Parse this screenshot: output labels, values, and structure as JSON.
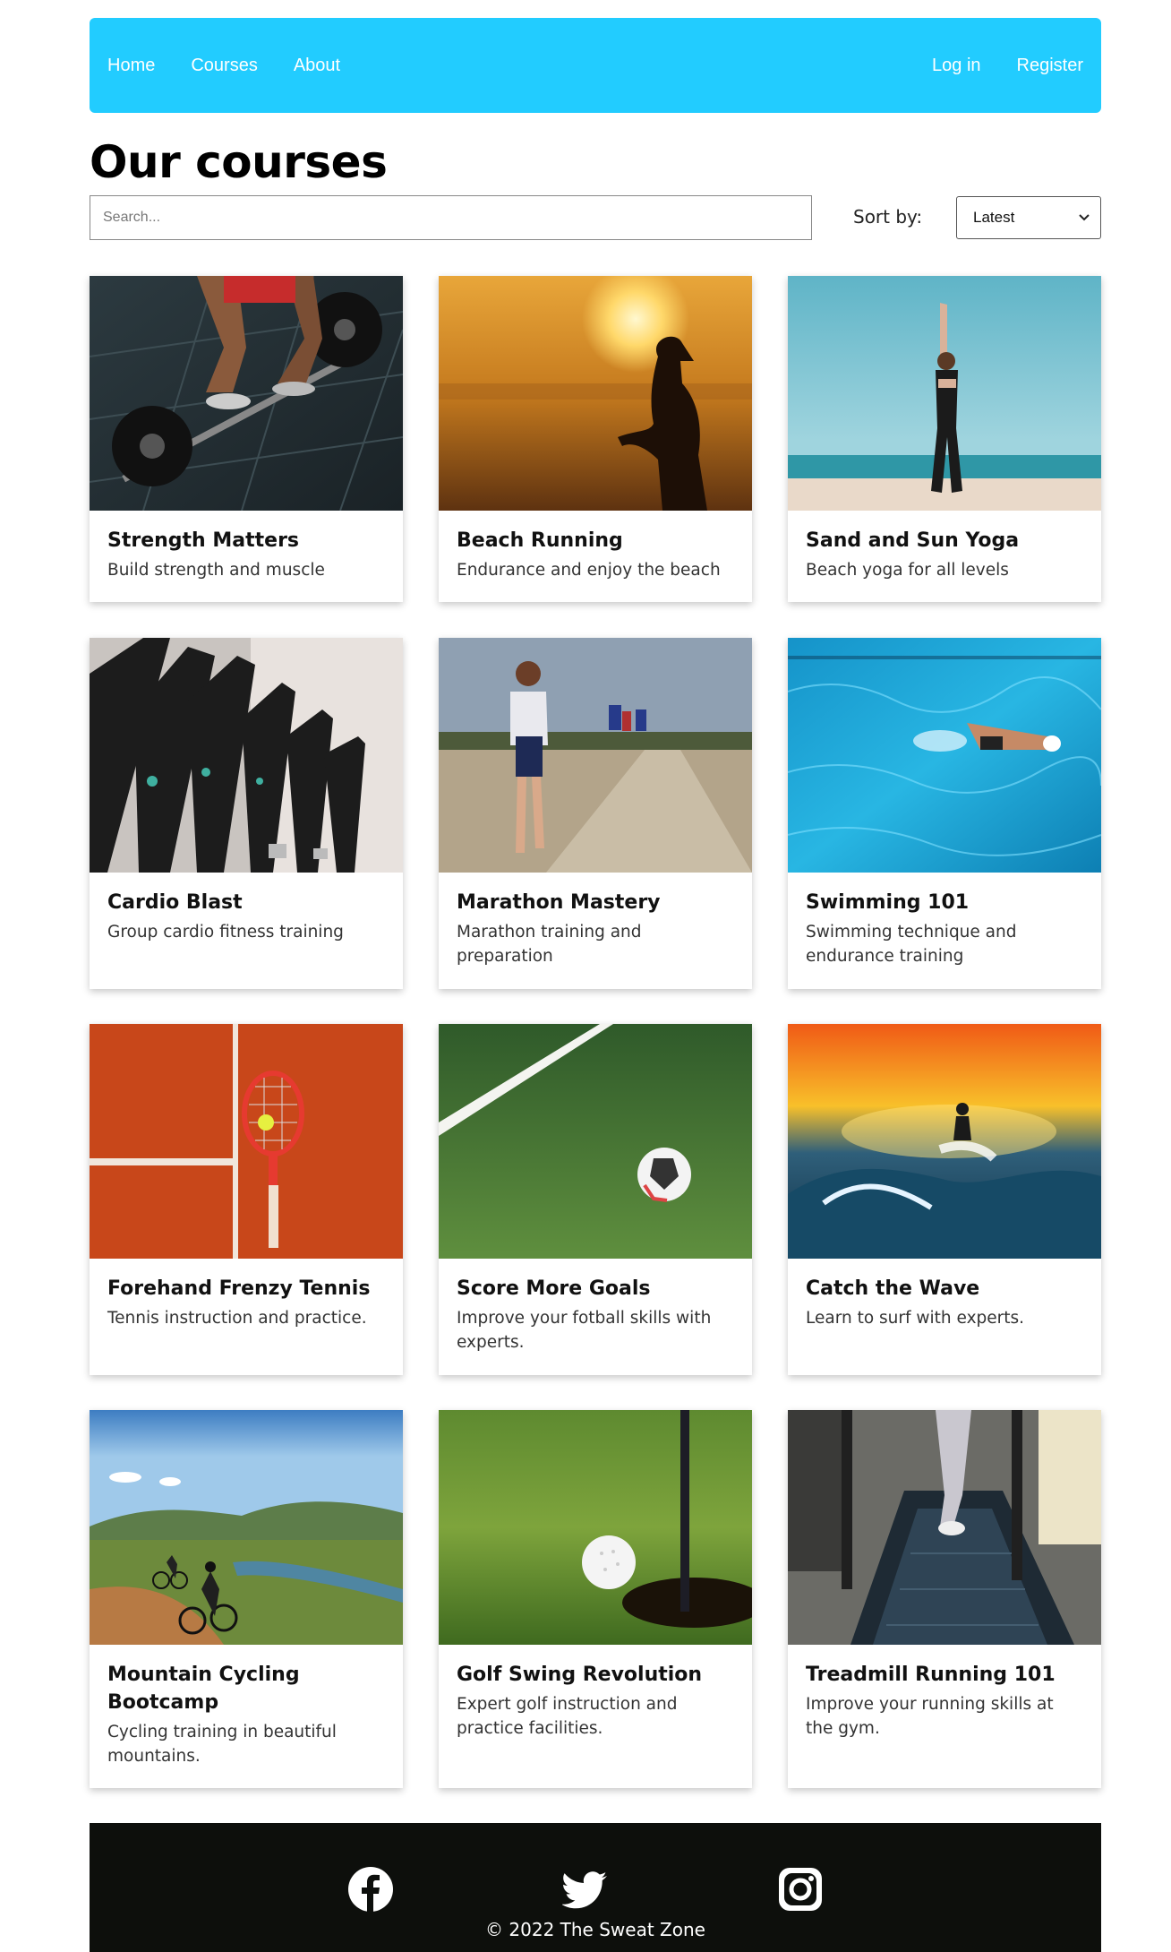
{
  "nav": {
    "left_links": [
      "Home",
      "Courses",
      "About"
    ],
    "right_links": [
      "Log in",
      "Register"
    ],
    "background": "#22ccff"
  },
  "page_title": "Our courses",
  "search": {
    "placeholder": "Search...",
    "value": ""
  },
  "sort": {
    "label": "Sort by:",
    "selected": "Latest"
  },
  "courses": [
    {
      "title": "Strength Matters",
      "description": "Build strength and muscle",
      "image": "barbell-deadlift-photo"
    },
    {
      "title": "Beach Running",
      "description": "Endurance and enjoy the beach",
      "image": "sunset-runner-silhouette-photo"
    },
    {
      "title": "Sand and Sun Yoga",
      "description": "Beach yoga for all levels",
      "image": "beach-yoga-pose-photo"
    },
    {
      "title": "Cardio Blast",
      "description": "Group cardio fitness training",
      "image": "spin-bikes-row-photo"
    },
    {
      "title": "Marathon Mastery",
      "description": "Marathon training and preparation",
      "image": "marathon-runners-road-photo"
    },
    {
      "title": "Swimming 101",
      "description": "Swimming technique and endurance training",
      "image": "swimmer-pool-photo"
    },
    {
      "title": "Forehand Frenzy Tennis",
      "description": "Tennis instruction and practice.",
      "image": "tennis-racket-clay-court-photo"
    },
    {
      "title": "Score More Goals",
      "description": "Improve your fotball skills with experts.",
      "image": "soccer-ball-grass-photo"
    },
    {
      "title": "Catch the Wave",
      "description": "Learn to surf with experts.",
      "image": "surfer-sunset-wave-photo"
    },
    {
      "title": "Mountain Cycling Bootcamp",
      "description": "Cycling training in beautiful mountains.",
      "image": "mountain-bikers-trail-photo"
    },
    {
      "title": "Golf Swing Revolution",
      "description": "Expert golf instruction and practice facilities.",
      "image": "golf-ball-hole-photo"
    },
    {
      "title": "Treadmill Running 101",
      "description": "Improve your running skills at the gym.",
      "image": "treadmill-runner-photo"
    }
  ],
  "footer": {
    "icons": [
      "facebook-icon",
      "twitter-icon",
      "instagram-icon"
    ],
    "copyright": "© 2022 The Sweat Zone"
  }
}
